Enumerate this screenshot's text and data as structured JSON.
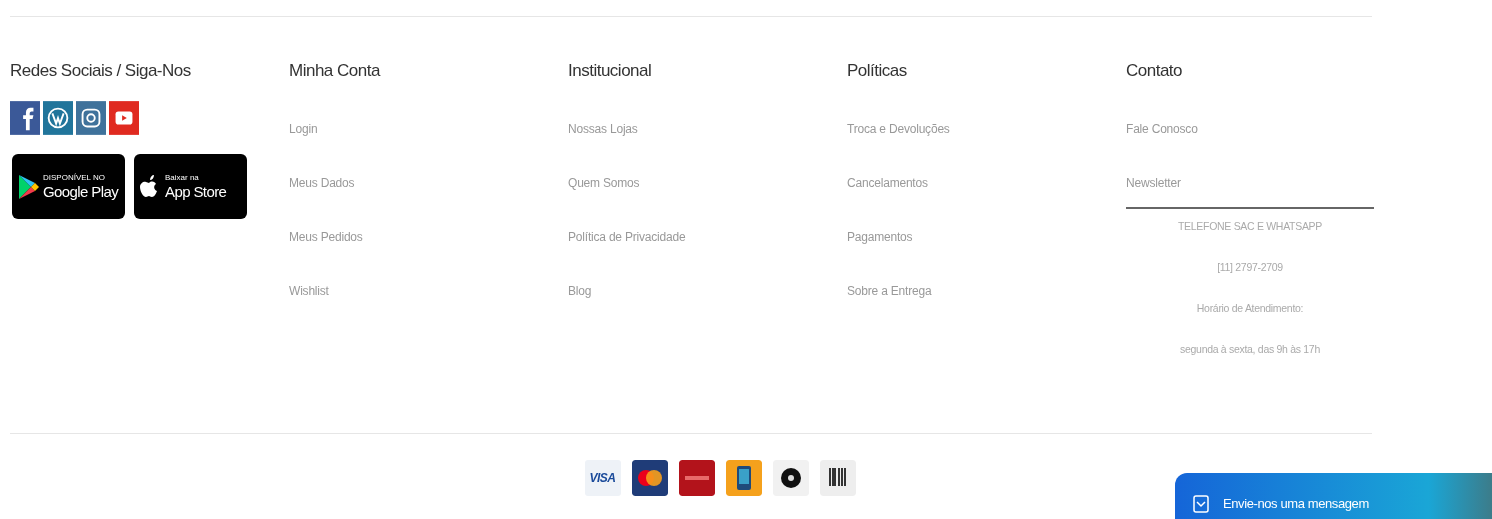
{
  "columns": [
    {
      "kind": "social",
      "heading": "Redes Sociais / Siga-Nos",
      "social": [
        {
          "kind": "facebook"
        },
        {
          "kind": "wordpress"
        },
        {
          "kind": "instagram"
        },
        {
          "kind": "youtube"
        }
      ],
      "apps": [
        {
          "kind": "google",
          "small": "DISPONÍVEL NO",
          "big": "Google Play"
        },
        {
          "kind": "apple",
          "small": "Baixar na",
          "big": "App Store"
        }
      ]
    },
    {
      "kind": "links",
      "heading": "Minha Conta",
      "links": [
        "Login",
        "Meus Dados",
        "Meus Pedidos",
        "Wishlist"
      ]
    },
    {
      "kind": "links",
      "heading": "Institucional",
      "links": [
        "Nossas Lojas",
        "Quem Somos",
        "Política de Privacidade",
        "Blog"
      ]
    },
    {
      "kind": "links",
      "heading": "Políticas",
      "links": [
        "Troca e Devoluções",
        "Cancelamentos",
        "Pagamentos",
        "Sobre a Entrega"
      ]
    },
    {
      "kind": "contact",
      "heading": "Contato",
      "links": [
        "Fale Conosco",
        "Newsletter"
      ],
      "info": [
        "TELEFONE SAC E WHATSAPP",
        "[11] 2797-2709",
        "Horário de Atendimento:",
        "segunda à sexta, das 9h às 17h"
      ]
    }
  ],
  "payments": [
    {
      "kind": "visa",
      "label": "VISA"
    },
    {
      "kind": "mastercard"
    },
    {
      "kind": "hipercard"
    },
    {
      "kind": "phone"
    },
    {
      "kind": "elo"
    },
    {
      "kind": "boleto"
    }
  ],
  "chat": {
    "label": "Envie-nos uma mensagem"
  }
}
